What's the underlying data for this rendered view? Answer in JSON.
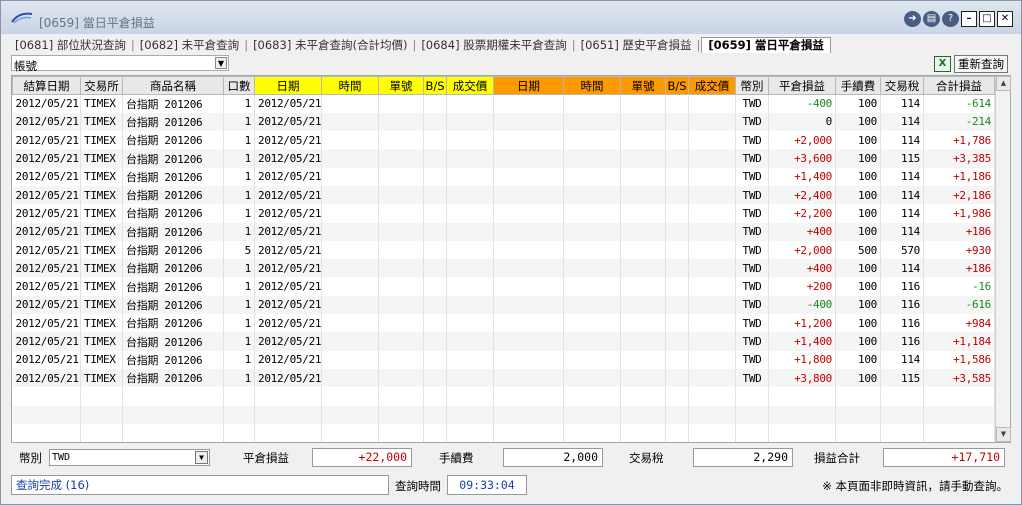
{
  "window": {
    "title": "[0659] 當日平倉損益"
  },
  "tabs": [
    {
      "label": "[0681] 部位狀況查詢"
    },
    {
      "label": "[0682] 未平倉查詢"
    },
    {
      "label": "[0683] 未平倉查詢(合計均價)"
    },
    {
      "label": "[0684] 股票期權未平倉查詢"
    },
    {
      "label": "[0651] 歷史平倉損益"
    },
    {
      "label": "[0659] 當日平倉損益"
    }
  ],
  "toolbar": {
    "account_label": "帳號",
    "account_value": "",
    "requery_label": "重新查詢",
    "export_icon": "excel-icon"
  },
  "columns": [
    "結算日期",
    "交易所",
    "商品名稱",
    "口數",
    "日期",
    "時間",
    "單號",
    "B/S",
    "成交價",
    "日期",
    "時間",
    "單號",
    "B/S",
    "成交價",
    "幣別",
    "平倉損益",
    "手續費",
    "交易稅",
    "合計損益"
  ],
  "rows": [
    [
      "2012/05/21",
      "TIMEX",
      "台指期 201206",
      "1",
      "2012/05/21",
      "TWD",
      "-400",
      "100",
      "114",
      "-614"
    ],
    [
      "2012/05/21",
      "TIMEX",
      "台指期 201206",
      "1",
      "2012/05/21",
      "TWD",
      "0",
      "100",
      "114",
      "-214"
    ],
    [
      "2012/05/21",
      "TIMEX",
      "台指期 201206",
      "1",
      "2012/05/21",
      "TWD",
      "+2,000",
      "100",
      "114",
      "+1,786"
    ],
    [
      "2012/05/21",
      "TIMEX",
      "台指期 201206",
      "1",
      "2012/05/21",
      "TWD",
      "+3,600",
      "100",
      "115",
      "+3,385"
    ],
    [
      "2012/05/21",
      "TIMEX",
      "台指期 201206",
      "1",
      "2012/05/21",
      "TWD",
      "+1,400",
      "100",
      "114",
      "+1,186"
    ],
    [
      "2012/05/21",
      "TIMEX",
      "台指期 201206",
      "1",
      "2012/05/21",
      "TWD",
      "+2,400",
      "100",
      "114",
      "+2,186"
    ],
    [
      "2012/05/21",
      "TIMEX",
      "台指期 201206",
      "1",
      "2012/05/21",
      "TWD",
      "+2,200",
      "100",
      "114",
      "+1,986"
    ],
    [
      "2012/05/21",
      "TIMEX",
      "台指期 201206",
      "1",
      "2012/05/21",
      "TWD",
      "+400",
      "100",
      "114",
      "+186"
    ],
    [
      "2012/05/21",
      "TIMEX",
      "台指期 201206",
      "5",
      "2012/05/21",
      "TWD",
      "+2,000",
      "500",
      "570",
      "+930"
    ],
    [
      "2012/05/21",
      "TIMEX",
      "台指期 201206",
      "1",
      "2012/05/21",
      "TWD",
      "+400",
      "100",
      "114",
      "+186"
    ],
    [
      "2012/05/21",
      "TIMEX",
      "台指期 201206",
      "1",
      "2012/05/21",
      "TWD",
      "+200",
      "100",
      "116",
      "-16"
    ],
    [
      "2012/05/21",
      "TIMEX",
      "台指期 201206",
      "1",
      "2012/05/21",
      "TWD",
      "-400",
      "100",
      "116",
      "-616"
    ],
    [
      "2012/05/21",
      "TIMEX",
      "台指期 201206",
      "1",
      "2012/05/21",
      "TWD",
      "+1,200",
      "100",
      "116",
      "+984"
    ],
    [
      "2012/05/21",
      "TIMEX",
      "台指期 201206",
      "1",
      "2012/05/21",
      "TWD",
      "+1,400",
      "100",
      "116",
      "+1,184"
    ],
    [
      "2012/05/21",
      "TIMEX",
      "台指期 201206",
      "1",
      "2012/05/21",
      "TWD",
      "+1,800",
      "100",
      "114",
      "+1,586"
    ],
    [
      "2012/05/21",
      "TIMEX",
      "台指期 201206",
      "1",
      "2012/05/21",
      "TWD",
      "+3,800",
      "100",
      "115",
      "+3,585"
    ]
  ],
  "summary": {
    "currency_label": "幣別",
    "currency_value": "TWD",
    "pnl_label": "平倉損益",
    "pnl_value": "+22,000",
    "fee_label": "手續費",
    "fee_value": "2,000",
    "tax_label": "交易稅",
    "tax_value": "2,290",
    "total_label": "損益合計",
    "total_value": "+17,710"
  },
  "status": {
    "message": "查詢完成 (16)",
    "time_label": "查詢時間",
    "time_value": "09:33:04",
    "note": "※ 本頁面非即時資訊，請手動查詢。"
  },
  "colors": {
    "buy_header": "#ffff00",
    "sell_header": "#ff9900",
    "positive": "#c00000",
    "negative": "#1a8a1a"
  }
}
